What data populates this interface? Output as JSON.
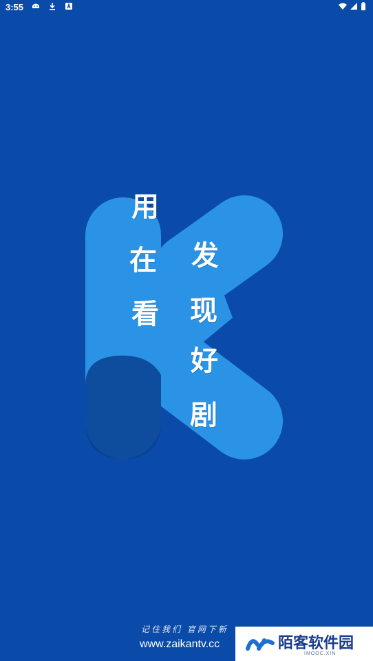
{
  "status_bar": {
    "time": "3:55",
    "left_icons": [
      "android-debug-icon",
      "download-icon",
      "app-notification-icon"
    ],
    "right_icons": [
      "wifi-icon",
      "signal-icon",
      "battery-icon"
    ]
  },
  "splash": {
    "background_color": "#0a4aa8",
    "logo_color": "#2b93e6",
    "logo_shadow_color": "#093f8f",
    "left_column": [
      "用",
      "在",
      "看"
    ],
    "right_column": [
      "发",
      "现",
      "好",
      "剧"
    ]
  },
  "footer": {
    "slogan": "记住我们 官网下新",
    "url": "www.zaikantv.cc"
  },
  "watermark": {
    "title": "陌客软件园",
    "subtitle": "IMOOC.XIN",
    "logo_color": "#1f6fd1"
  }
}
